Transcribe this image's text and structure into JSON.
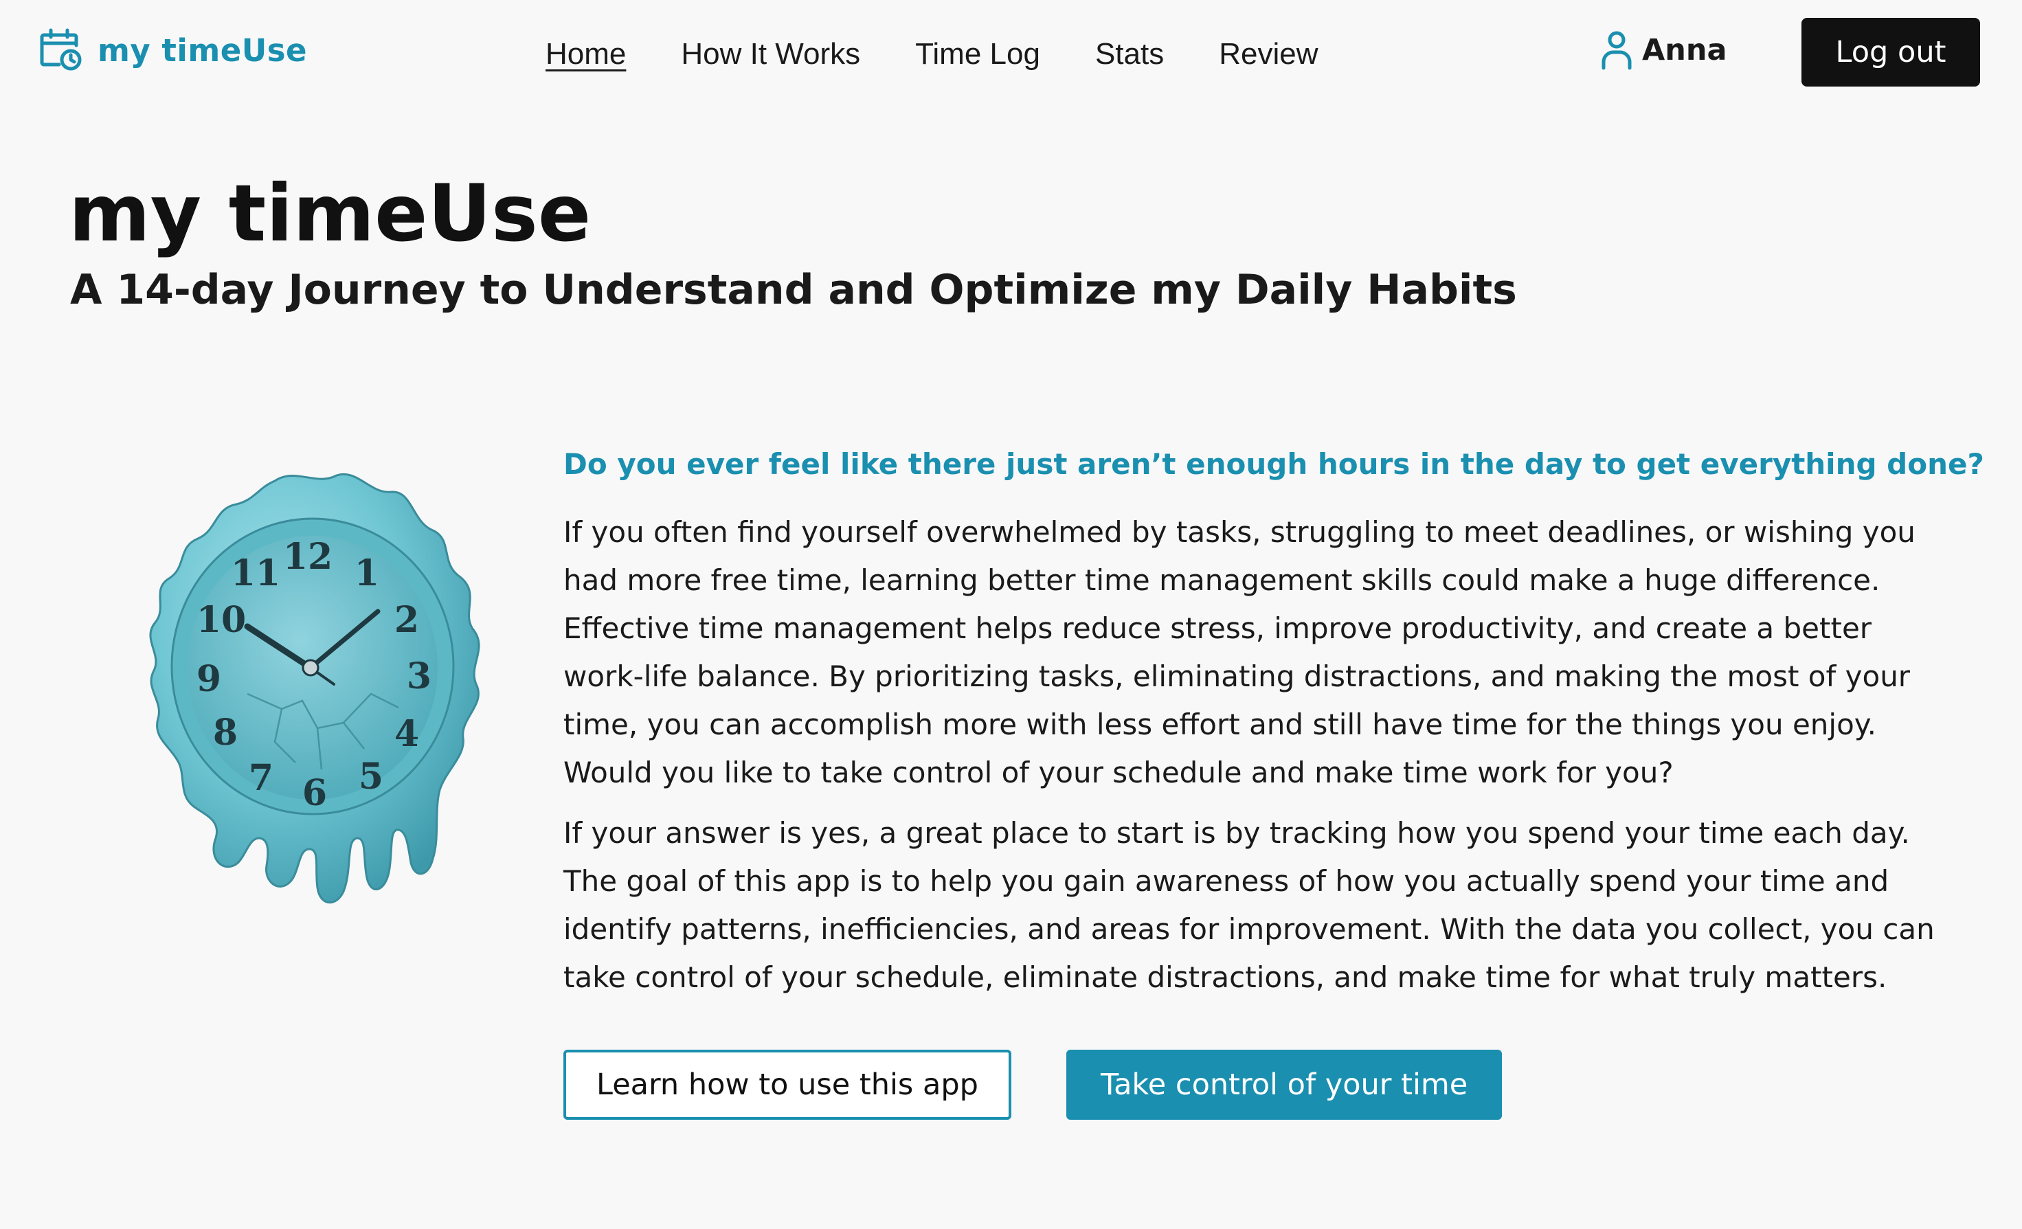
{
  "brand": {
    "name": "my timeUse",
    "icon": "calendar-clock-icon",
    "color": "#1a8fb0"
  },
  "nav": {
    "links": [
      {
        "label": "Home",
        "active": true
      },
      {
        "label": "How It Works",
        "active": false
      },
      {
        "label": "Time Log",
        "active": false
      },
      {
        "label": "Stats",
        "active": false
      },
      {
        "label": "Review",
        "active": false
      }
    ]
  },
  "user": {
    "name": "Anna",
    "icon": "user-icon"
  },
  "logout_label": "Log out",
  "hero": {
    "title": "my timeUse",
    "subtitle": "A 14-day Journey to Understand and Optimize my Daily Habits"
  },
  "illustration": {
    "icon": "melting-clock-image",
    "numerals": [
      "12",
      "1",
      "2",
      "3",
      "4",
      "5",
      "6",
      "7",
      "8",
      "9",
      "10",
      "11"
    ]
  },
  "content": {
    "question": "Do you ever feel like there just aren’t enough hours in the day to get everything done?",
    "paragraphs": [
      "If you often find yourself overwhelmed by tasks, struggling to meet deadlines, or wishing you had more free time, learning better time management skills could make a huge difference. Effective time management helps reduce stress, improve productivity, and create a better work-life balance. By prioritizing tasks, eliminating distractions, and making the most of your time, you can accomplish more with less effort and still have time for the things you enjoy. Would you like to take control of your schedule and make time work for you?",
      "If your answer is yes, a great place to start is by tracking how you spend your time each day. The goal of this app is to help you gain awareness of how you actually spend your time and identify patterns, inefficiencies, and areas for improvement. With the data you collect, you can take control of your schedule, eliminate distractions, and make time for what truly matters."
    ]
  },
  "buttons": {
    "learn_label": "Learn how to use this app",
    "take_control_label": "Take control of your time"
  },
  "colors": {
    "accent": "#1a8fb0",
    "background": "#f8f8f8",
    "logout_bg": "#111111",
    "clock_body": "#6fc6d3"
  }
}
